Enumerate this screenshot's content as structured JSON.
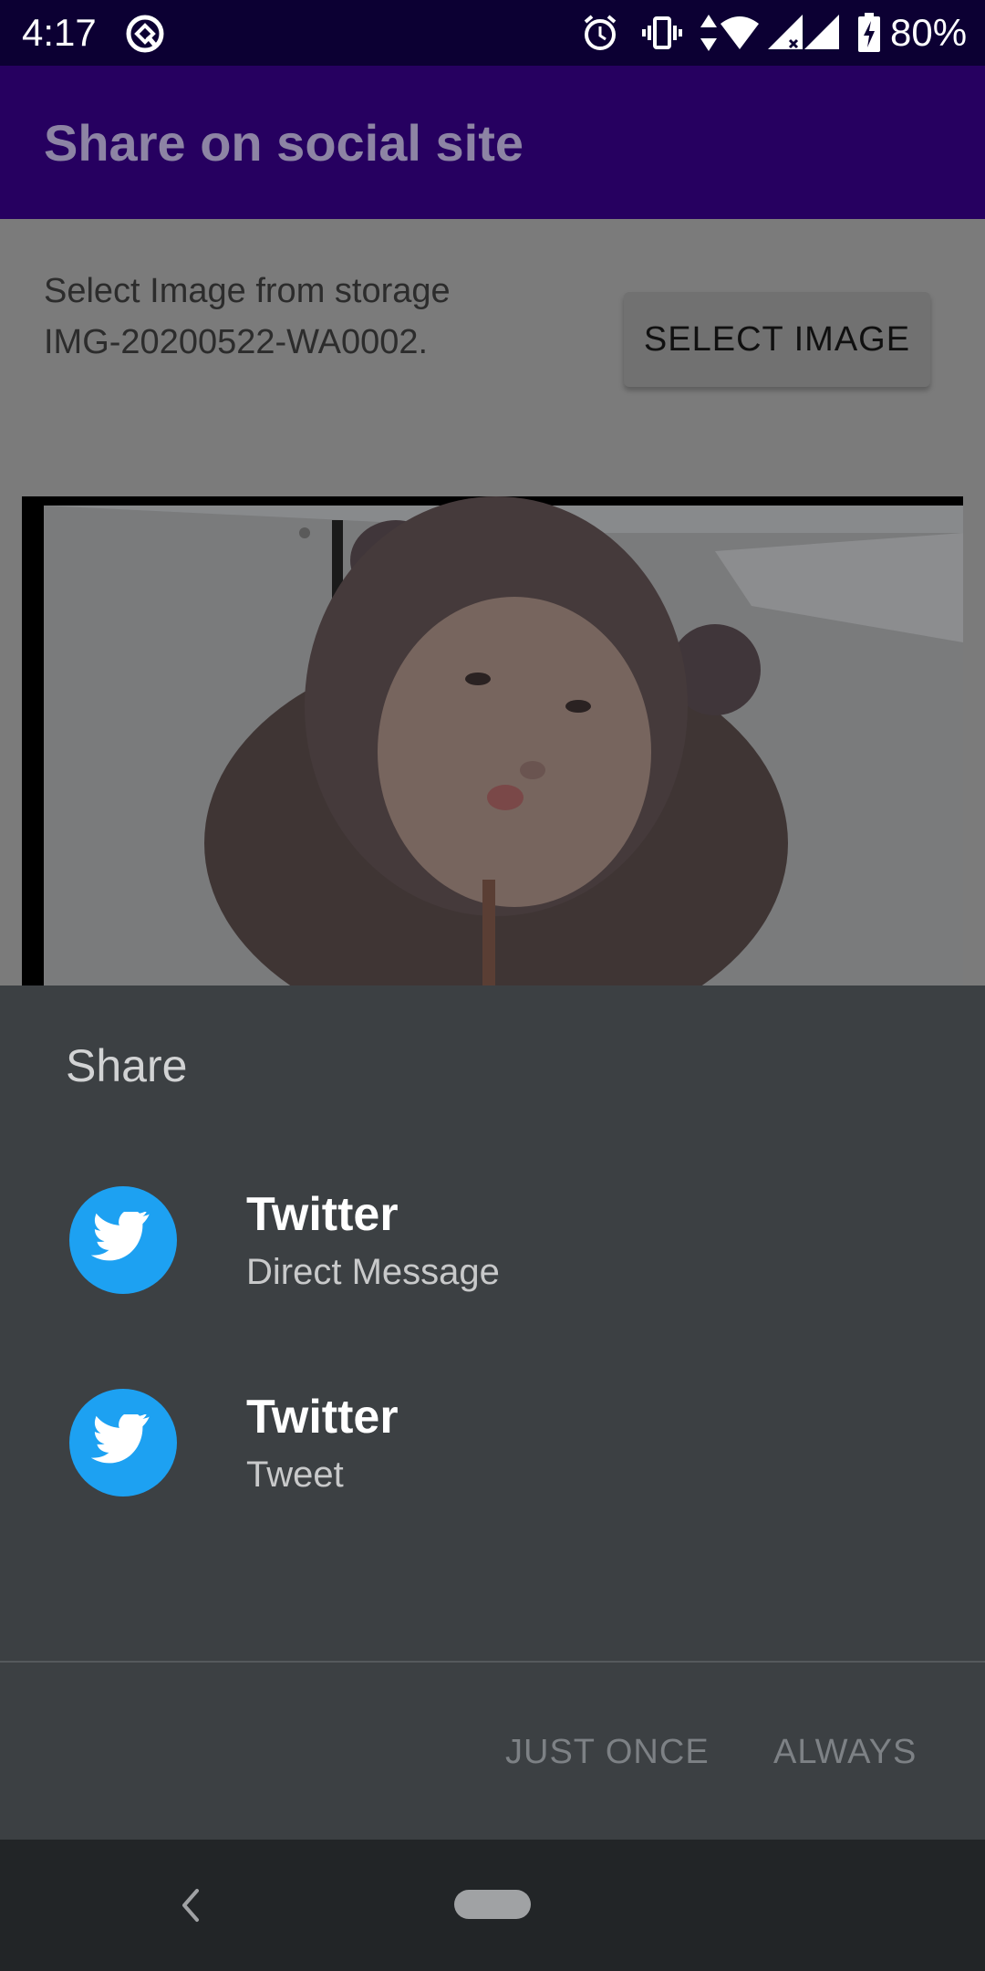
{
  "status_bar": {
    "time": "4:17",
    "battery": "80%",
    "icons": [
      "app-notification-icon",
      "alarm-icon",
      "vibrate-icon",
      "data-arrows-icon",
      "wifi-icon",
      "signal-icon",
      "signal-icon",
      "battery-charging-icon"
    ]
  },
  "app_bar": {
    "title": "Share on social site"
  },
  "content": {
    "storage_label": "Select Image from storage",
    "filename": "IMG-20200522-WA0002.",
    "select_button": "SELECT IMAGE"
  },
  "share_sheet": {
    "title": "Share",
    "items": [
      {
        "app": "Twitter",
        "action": "Direct Message",
        "icon": "twitter-bird-icon"
      },
      {
        "app": "Twitter",
        "action": "Tweet",
        "icon": "twitter-bird-icon"
      }
    ],
    "just_once": "JUST ONCE",
    "always": "ALWAYS"
  },
  "colors": {
    "status_bar": "#0c0033",
    "app_bar": "#260060",
    "sheet": "#3c4043",
    "twitter_blue": "#1da1f2",
    "nav_bar": "#222527"
  }
}
